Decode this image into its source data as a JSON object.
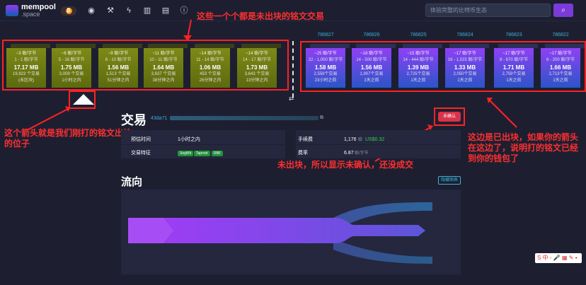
{
  "logo": {
    "name": "mempool",
    "sub": ".space"
  },
  "nav_icons": [
    "dashboard-icon",
    "hammer-icon",
    "lightning-icon",
    "chart-icon",
    "docs-icon",
    "info-icon"
  ],
  "search": {
    "placeholder": "体验完整的比特币生态"
  },
  "pending_blocks": [
    {
      "fee": "~3 聪/字节",
      "range": "1 - 1 聪/字节",
      "size": "17.17 MB",
      "txs": "19,923 个交易",
      "time": "(未区块)"
    },
    {
      "fee": "~6 聪/字节",
      "range": "5 - 16 聪/字节",
      "size": "1.75 MB",
      "txs": "3,009 个交易",
      "time": "1小时之内"
    },
    {
      "fee": "~9 聪/字节",
      "range": "8 - 10 聪/字节",
      "size": "1.56 MB",
      "txs": "1,513 个交易",
      "time": "51分钟之内"
    },
    {
      "fee": "~11 聪/字节",
      "range": "10 - 11 聪/字节",
      "size": "1.64 MB",
      "txs": "3,637 个交易",
      "time": "38分钟之内"
    },
    {
      "fee": "~14 聪/字节",
      "range": "11 - 14 聪/字节",
      "size": "1.06 MB",
      "txs": "453 个交易",
      "time": "26分钟之内"
    },
    {
      "fee": "~14 聪/字节",
      "range": "14 - 17 聪/字节",
      "size": "1.73 MB",
      "txs": "3,643 个交易",
      "time": "13分钟之内"
    }
  ],
  "mined_blocks": [
    {
      "height": "786827",
      "fee": "~25 聪/字节",
      "range": "22 - 1,000 聪/字节",
      "size": "1.58 MB",
      "txs": "2,559个交易",
      "time": "23小时之前"
    },
    {
      "height": "786826",
      "fee": "~18 聪/字节",
      "range": "14 - 500 聪/字节",
      "size": "1.56 MB",
      "txs": "1,907个交易",
      "time": "1天之前"
    },
    {
      "height": "786825",
      "fee": "~15 聪/字节",
      "range": "14 - 444 聪/字节",
      "size": "1.39 MB",
      "txs": "2,725个交易",
      "time": "1天之前"
    },
    {
      "height": "786824",
      "fee": "~17 聪/字节",
      "range": "16 - 1,025 聪/字节",
      "size": "1.33 MB",
      "txs": "2,050个交易",
      "time": "1天之前"
    },
    {
      "height": "786823",
      "fee": "~17 聪/字节",
      "range": "8 - 670 聪/字节",
      "size": "1.71 MB",
      "txs": "2,759个交易",
      "time": "1天之前"
    },
    {
      "height": "786822",
      "fee": "~17 聪/字节",
      "range": "6 - 200 聪/字节",
      "size": "1.66 MB",
      "txs": "2,713个交易",
      "time": "1天之前"
    }
  ],
  "tx": {
    "title": "交易",
    "id_prefix": "43da71",
    "status": "未确认",
    "eta_label": "预估时间",
    "eta_value": "1小时之内",
    "features_label": "交易特征",
    "features": [
      "SegWit",
      "Taproot",
      "RBF"
    ],
    "fee_label": "手续费",
    "fee_sats": "1,176",
    "fee_unit": "聪",
    "fee_usd": "US$0.32",
    "rate_label": "费率",
    "rate_value": "6.87",
    "rate_unit": "聪/字节"
  },
  "flow": {
    "title": "流向",
    "hide_label": "隐藏图表"
  },
  "annotations": {
    "top": "这些一个个都是未出块的铭文交易",
    "left": "这个箭头就是我们刚打的铭文出块 的位子",
    "middle": "未出块，所以显示未确认，还没成交",
    "right": "这边是已出块，如果你的箭头在这边了，说明打的铭文已经到你的钱包了"
  },
  "colors": {
    "accent": "#7b3bd8",
    "pending": "#7d8a16",
    "mined": "#8f40f6",
    "annotation": "#ff2222",
    "link": "#3bb2d6"
  }
}
